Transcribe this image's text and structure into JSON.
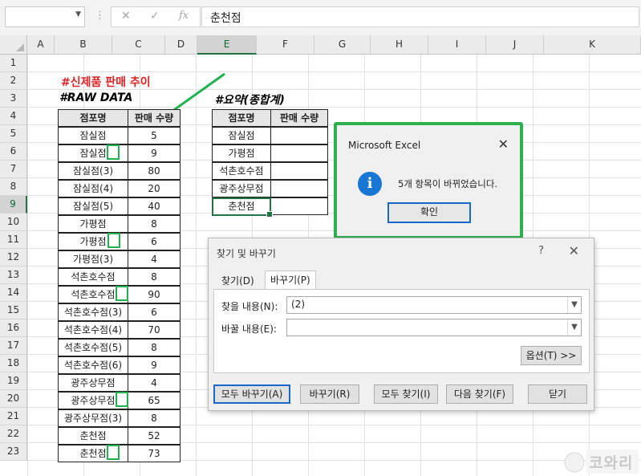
{
  "formula_bar": {
    "name_box": "",
    "cancel_glyph": "✕",
    "enter_glyph": "✓",
    "fx_glyph": "fx",
    "value": "춘천점"
  },
  "columns": [
    "A",
    "B",
    "C",
    "D",
    "E",
    "F",
    "G",
    "H",
    "I",
    "J",
    "K"
  ],
  "rows": [
    "1",
    "2",
    "3",
    "4",
    "5",
    "6",
    "7",
    "8",
    "9",
    "10",
    "11",
    "12",
    "13",
    "14",
    "15",
    "16",
    "17",
    "18",
    "19",
    "20",
    "21",
    "22",
    "23"
  ],
  "sheet": {
    "title_new_product": "#신제품 판매 추이",
    "title_raw": "#RAW DATA",
    "title_summary": "#요약(종합계)",
    "raw_headers": [
      "점포명",
      "판매 수량"
    ],
    "raw_rows": [
      [
        "잠실점",
        "5"
      ],
      [
        "잠실점",
        "9"
      ],
      [
        "잠실점(3)",
        "80"
      ],
      [
        "잠실점(4)",
        "20"
      ],
      [
        "잠실점(5)",
        "40"
      ],
      [
        "가평점",
        "8"
      ],
      [
        "가평점",
        "6"
      ],
      [
        "가평점(3)",
        "4"
      ],
      [
        "석촌호수점",
        "8"
      ],
      [
        "석촌호수점",
        "90"
      ],
      [
        "석촌호수점(3)",
        "6"
      ],
      [
        "석촌호수점(4)",
        "70"
      ],
      [
        "석촌호수점(5)",
        "8"
      ],
      [
        "석촌호수점(6)",
        "9"
      ],
      [
        "광주상무점",
        "4"
      ],
      [
        "광주상무점",
        "65"
      ],
      [
        "광주상무점(3)",
        "8"
      ],
      [
        "춘천점",
        "52"
      ],
      [
        "춘천점",
        "73"
      ]
    ],
    "summary_headers": [
      "점포명",
      "판매 수량"
    ],
    "summary_rows": [
      [
        "잠실점",
        ""
      ],
      [
        "가평점",
        ""
      ],
      [
        "석촌호수점",
        ""
      ],
      [
        "광주상무점",
        ""
      ],
      [
        "춘천점",
        ""
      ]
    ]
  },
  "message_box": {
    "title": "Microsoft Excel",
    "close_glyph": "✕",
    "icon": "info-icon",
    "icon_glyph": "i",
    "message": "5개 항목이 바뀌었습니다.",
    "ok_label": "확인"
  },
  "find_replace": {
    "title": "찾기 및 바꾸기",
    "help_glyph": "?",
    "close_glyph": "✕",
    "tabs": [
      "찾기(D)",
      "바꾸기(P)"
    ],
    "find_label": "찾을 내용(N):",
    "find_value": "(2)",
    "replace_label": "바꿀 내용(E):",
    "replace_value": "",
    "options_label": "옵션(T) >>",
    "buttons": [
      "모두 바꾸기(A)",
      "바꾸기(R)",
      "모두 찾기(I)",
      "다음 찾기(F)",
      "닫기"
    ]
  },
  "logo_text": "코와리",
  "colors": {
    "highlight_green": "#22b150",
    "title_red": "#e22222",
    "excel_green": "#217346",
    "info_blue": "#1877d2"
  }
}
